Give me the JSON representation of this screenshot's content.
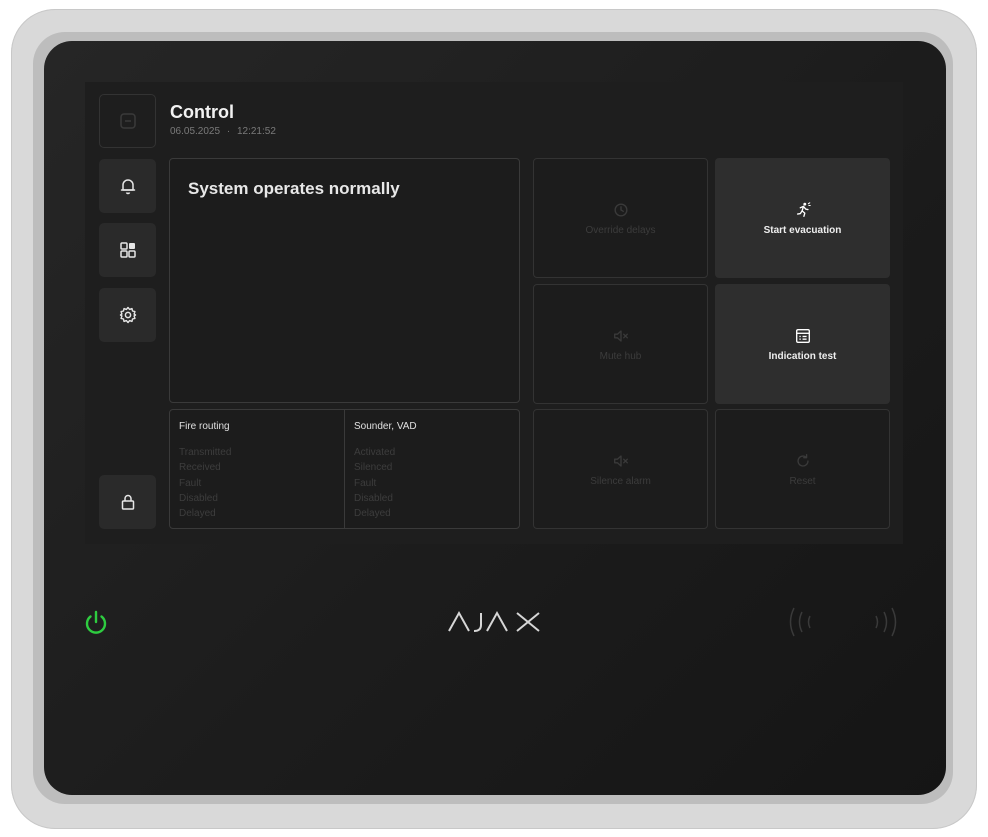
{
  "header": {
    "title": "Control",
    "date": "06.05.2025",
    "separator": "·",
    "time": "12:21:52"
  },
  "sidebar": {
    "items": [
      {
        "icon": "minus-square-icon"
      },
      {
        "icon": "bell-icon"
      },
      {
        "icon": "dashboard-icon"
      },
      {
        "icon": "gear-icon"
      },
      {
        "icon": "lock-icon"
      }
    ]
  },
  "status": {
    "message": "System operates normally"
  },
  "fire_routing": {
    "title": "Fire routing",
    "items": [
      "Transmitted",
      "Received",
      "Fault",
      "Disabled",
      "Delayed"
    ]
  },
  "sounder": {
    "title": "Sounder, VAD",
    "items": [
      "Activated",
      "Silenced",
      "Fault",
      "Disabled",
      "Delayed"
    ]
  },
  "actions": {
    "override_delays": "Override delays",
    "start_evacuation": "Start evacuation",
    "mute_hub": "Mute hub",
    "indication_test": "Indication test",
    "silence_alarm": "Silence alarm",
    "reset": "Reset"
  },
  "brand": {
    "logo": "AJAX"
  },
  "colors": {
    "power_led": "#2ecc40",
    "background": "#1e1e1e",
    "text_primary": "#f2f2f2"
  }
}
